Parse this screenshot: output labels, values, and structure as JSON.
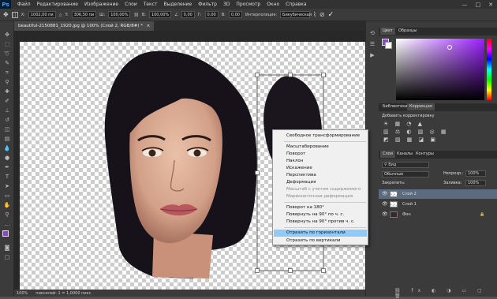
{
  "menubar": {
    "logo": "Ps",
    "items": [
      "Файл",
      "Редактирование",
      "Изображение",
      "Слои",
      "Текст",
      "Выделение",
      "Фильтр",
      "3D",
      "Просмотр",
      "Окно",
      "Справка"
    ],
    "minimize": "—",
    "maximize": "□",
    "close": "✕"
  },
  "options": {
    "x_label": "X:",
    "x_value": "1002,00 пи",
    "y_label": "Y:",
    "y_value": "306,50 пи",
    "w_label": "Ш:",
    "w_value": "100,00%",
    "h_label": "В:",
    "h_value": "100,00%",
    "angle_value": "0,00",
    "h2_label": "Г:",
    "h2_value": "0,00",
    "v2_label": "В:",
    "v2_value": "0,00",
    "interp_label": "Интерполяция:",
    "interp_value": "Бикубическая"
  },
  "document": {
    "tab_title": "beautiful-2150881_1920.jpg @ 100% (Слой 2, RGB/8#) *",
    "tab_close": "×",
    "zoom": "100%",
    "status": "пикселей: 1 = 1,0000 пикс."
  },
  "context_menu": {
    "items": [
      {
        "label": "Свободное трансформирование",
        "enabled": true
      },
      {
        "label": "Масштабирование",
        "enabled": true
      },
      {
        "label": "Поворот",
        "enabled": true
      },
      {
        "label": "Наклон",
        "enabled": true
      },
      {
        "label": "Искажение",
        "enabled": true
      },
      {
        "label": "Перспектива",
        "enabled": true
      },
      {
        "label": "Деформация",
        "enabled": true
      },
      {
        "label": "Масштаб с учетом содержимого",
        "enabled": false
      },
      {
        "label": "Марионеточная деформация",
        "enabled": false
      },
      {
        "label": "Поворот на 180°",
        "enabled": true
      },
      {
        "label": "Повернуть на 90° по ч. с.",
        "enabled": true
      },
      {
        "label": "Повернуть на 90° против ч. с.",
        "enabled": true
      },
      {
        "label": "Отразить по горизонтали",
        "enabled": true,
        "highlighted": true
      },
      {
        "label": "Отразить по вертикали",
        "enabled": true
      }
    ]
  },
  "color_panel": {
    "tabs": [
      "Цвет",
      "Образцы"
    ],
    "active": "Цвет"
  },
  "adjust_panel": {
    "tabs": [
      "Библиотеки",
      "Коррекция"
    ],
    "active": "Коррекция",
    "title": "Добавить корректировку"
  },
  "layers_panel": {
    "tabs": [
      "Слои",
      "Каналы",
      "Контуры"
    ],
    "active": "Слои",
    "blend_mode": "Обычные",
    "opacity_label": "Непрозр.:",
    "opacity_value": "100%",
    "lock_label": "Закрепить:",
    "fill_label": "Заливка:",
    "fill_value": "100%",
    "layers": [
      {
        "name": "Слой 2",
        "selected": true
      },
      {
        "name": "Слой 1",
        "selected": false
      },
      {
        "name": "Фон",
        "selected": false
      }
    ]
  },
  "colors": {
    "menubar": "#323232",
    "panel": "#3b3b3b",
    "highlight": "#91c9f7",
    "foreground": "#8a47c8"
  }
}
